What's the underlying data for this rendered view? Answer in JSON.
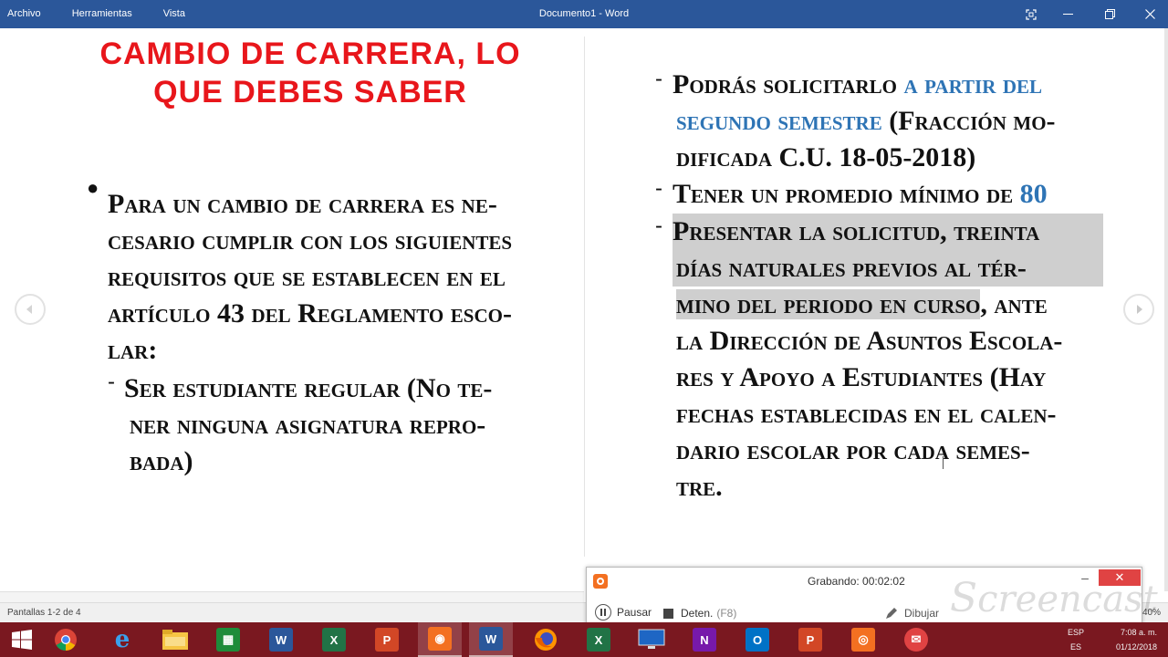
{
  "titlebar": {
    "menu": [
      "Archivo",
      "Herramientas",
      "Vista"
    ],
    "title": "Documento1 - Word"
  },
  "slide_left": {
    "title_line1": "CAMBIO DE CARRERA, LO",
    "title_line2": "QUE DEBES SABER",
    "para_lines": [
      "Para un cambio de carrera es ne-",
      "cesario cumplir con los siguientes",
      "requisitos que se establecen en el",
      "artículo 43 del Reglamento esco-",
      "lar:"
    ],
    "sub_lines": [
      "Ser estudiante regular (No te-",
      "ner ninguna asignatura repro-",
      "bada)"
    ]
  },
  "slide_right": {
    "item1": {
      "a": "Podrás solicitarlo ",
      "b": "a partir del",
      "c": "segundo semestre",
      "d": " (Fracción mo-",
      "e": "dificada C.U. 18-05-2018)"
    },
    "item2": {
      "a": "Tener un promedio mínimo de ",
      "b": "80"
    },
    "item3": {
      "l1": "Presentar la solicitud, treinta",
      "l2": "días naturales previos al tér-",
      "l3a": "mino del periodo en curso",
      "l3b": ", ante",
      "l4": "la Dirección de Asuntos Escola-",
      "l5": "res y Apoyo a Estudiantes (Hay",
      "l6": "fechas establecidas en el calen-",
      "l7": "dario escolar por cada semes-",
      "l8": "tre."
    }
  },
  "statusbar": {
    "pages": "Pantallas 1-2 de 4",
    "zoom": "40%"
  },
  "recorder": {
    "status": "Grabando:  00:02:02",
    "pause_label": "Pausar",
    "stop_label": "Deten.",
    "stop_key": "(F8)",
    "draw_label": "Dibujar",
    "watermark": "Screencast"
  },
  "taskbar": {
    "lang": "ESP",
    "lang_sub": "ES",
    "time": "7:08 a. m.",
    "date": "01/12/2018",
    "icons": [
      "windows-start",
      "chrome",
      "internet-explorer",
      "file-explorer",
      "store",
      "word",
      "excel",
      "powerpoint",
      "screencast",
      "word-active",
      "firefox",
      "excel-2",
      "lenovo",
      "onenote",
      "outlook",
      "powerpoint-2",
      "screencast-2",
      "mail"
    ]
  },
  "colors": {
    "titlebar": "#2b579a",
    "slide_title": "#e8161b",
    "accent_blue": "#2e74b5",
    "highlight": "#cfcfcf",
    "taskbar": "#7a1820"
  }
}
